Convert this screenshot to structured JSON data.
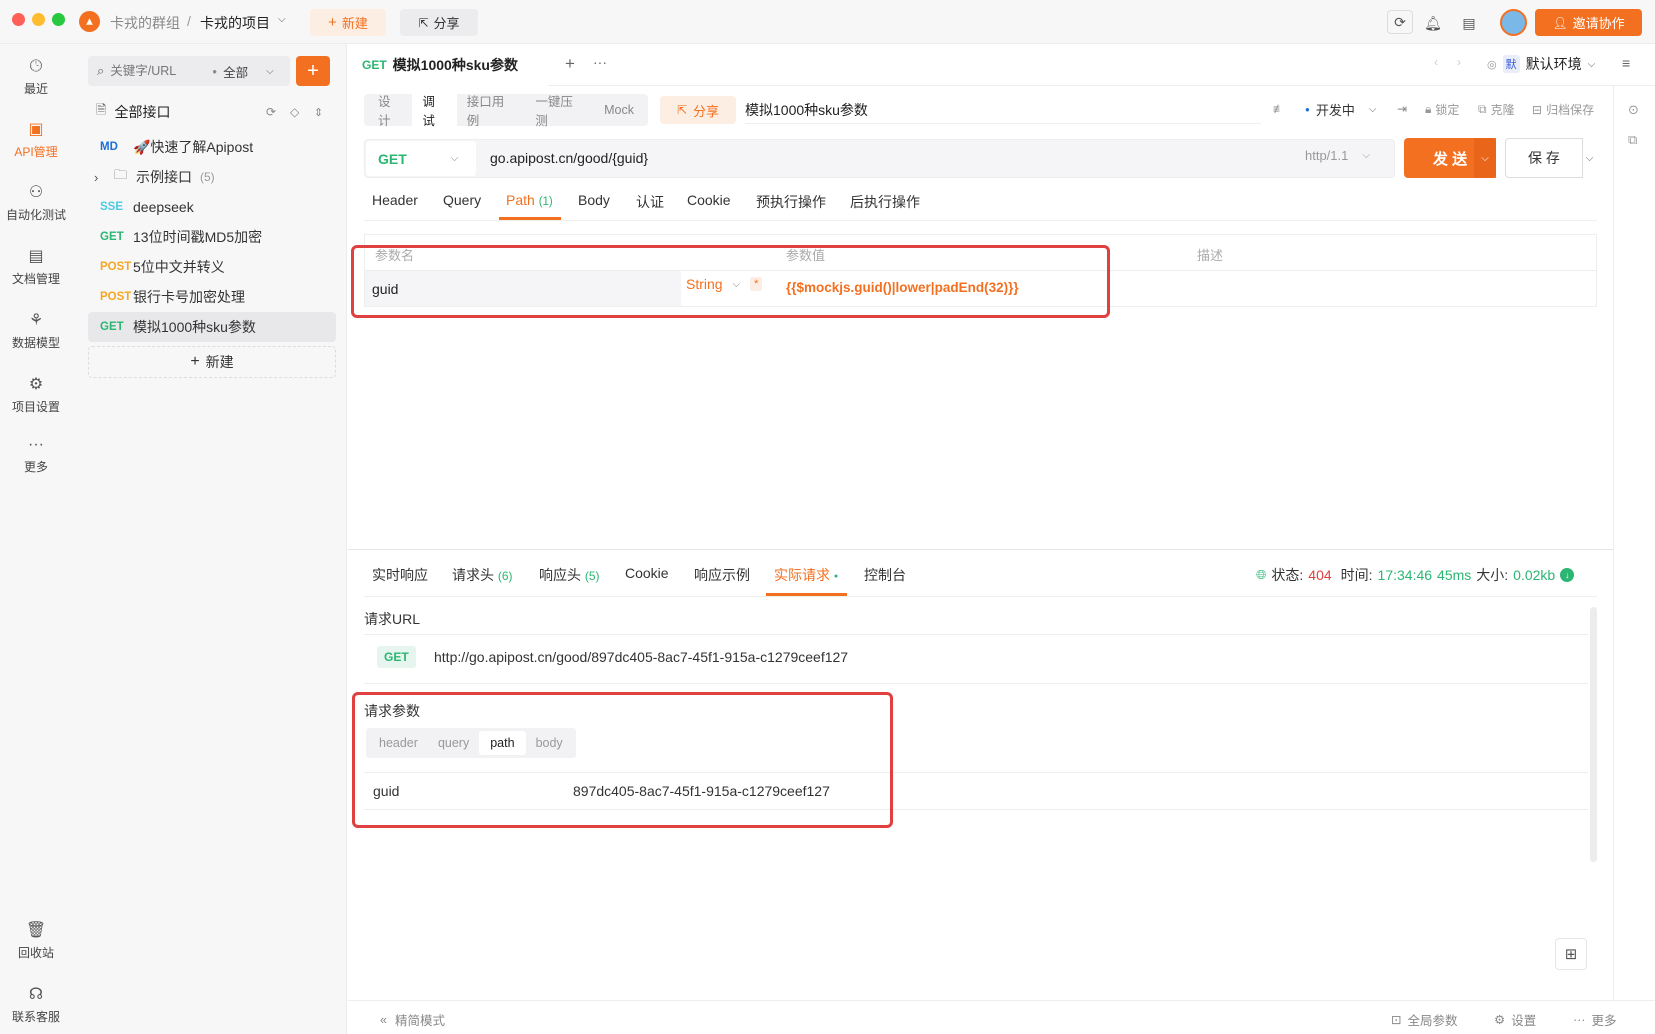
{
  "titlebar": {
    "group": "卡戎的群组",
    "separator": "/",
    "project": "卡戎的项目",
    "new_label": "新建",
    "share_label": "分享",
    "invite_label": "邀请协作"
  },
  "leftnav": [
    {
      "label": "最近",
      "icon": "clock-icon"
    },
    {
      "label": "API管理",
      "icon": "api-icon"
    },
    {
      "label": "自动化测试",
      "icon": "flow-icon"
    },
    {
      "label": "文档管理",
      "icon": "doc-icon"
    },
    {
      "label": "数据模型",
      "icon": "model-icon"
    },
    {
      "label": "项目设置",
      "icon": "settings-icon"
    },
    {
      "label": "更多",
      "icon": "more-icon"
    }
  ],
  "leftnav_bottom": [
    {
      "label": "回收站",
      "icon": "trash-icon"
    },
    {
      "label": "联系客服",
      "icon": "headset-icon"
    }
  ],
  "sidebar": {
    "search_placeholder": "关键字/URL",
    "filter": "全部",
    "all_label": "全部接口",
    "items": [
      {
        "method": "MD",
        "name": "🚀快速了解Apipost"
      },
      {
        "method": "",
        "name": "示例接口",
        "count": "(5)"
      },
      {
        "method": "SSE",
        "name": "deepseek"
      },
      {
        "method": "GET",
        "name": "13位时间戳MD5加密"
      },
      {
        "method": "POST",
        "name": "5位中文并转义"
      },
      {
        "method": "POST",
        "name": "银行卡号加密处理"
      },
      {
        "method": "GET",
        "name": "模拟1000种sku参数"
      }
    ],
    "new_label": "新建"
  },
  "tabbar": {
    "method": "GET",
    "title": "模拟1000种sku参数",
    "env_badge": "默",
    "env": "默认环境"
  },
  "toolbar": {
    "modes": [
      "设计",
      "调试",
      "接口用例",
      "一键压测",
      "Mock"
    ],
    "share": "分享",
    "name": "模拟1000种sku参数",
    "status": "开发中",
    "lock": "锁定",
    "clone": "克隆",
    "archive": "归档保存"
  },
  "request": {
    "method": "GET",
    "url": "go.apipost.cn/good/{guid}",
    "protocol": "http/1.1",
    "send": "发 送",
    "save": "保 存"
  },
  "request_tabs": [
    "Header",
    "Query",
    "Path",
    "Body",
    "认证",
    "Cookie",
    "预执行操作",
    "后执行操作"
  ],
  "path_count": "(1)",
  "params_table": {
    "headers": [
      "参数名",
      "参数值",
      "描述"
    ],
    "rows": [
      {
        "name": "guid",
        "type": "String",
        "required": "*",
        "value": "{{$mockjs.guid()|lower|padEnd(32)}}"
      }
    ]
  },
  "response_tabs": [
    {
      "label": "实时响应"
    },
    {
      "label": "请求头",
      "count": "(6)"
    },
    {
      "label": "响应头",
      "count": "(5)"
    },
    {
      "label": "Cookie"
    },
    {
      "label": "响应示例"
    },
    {
      "label": "实际请求"
    },
    {
      "label": "控制台"
    }
  ],
  "status_bar": {
    "status_label": "状态:",
    "status_value": "404",
    "time_label": "时间:",
    "time_value": "17:34:46",
    "duration": "45ms",
    "size_label": "大小:",
    "size_value": "0.02kb"
  },
  "actual": {
    "url_label": "请求URL",
    "method": "GET",
    "url": "http://go.apipost.cn/good/897dc405-8ac7-45f1-915a-c1279ceef127",
    "params_label": "请求参数",
    "param_tabs": [
      "header",
      "query",
      "path",
      "body"
    ],
    "param_name": "guid",
    "param_value": "897dc405-8ac7-45f1-915a-c1279ceef127"
  },
  "footer": {
    "simple_mode": "精简模式",
    "global_params": "全局参数",
    "settings": "设置",
    "more": "更多"
  },
  "colors": {
    "accent": "#f37021",
    "get": "#2bb673",
    "post": "#f5a623",
    "error": "#e04040"
  }
}
